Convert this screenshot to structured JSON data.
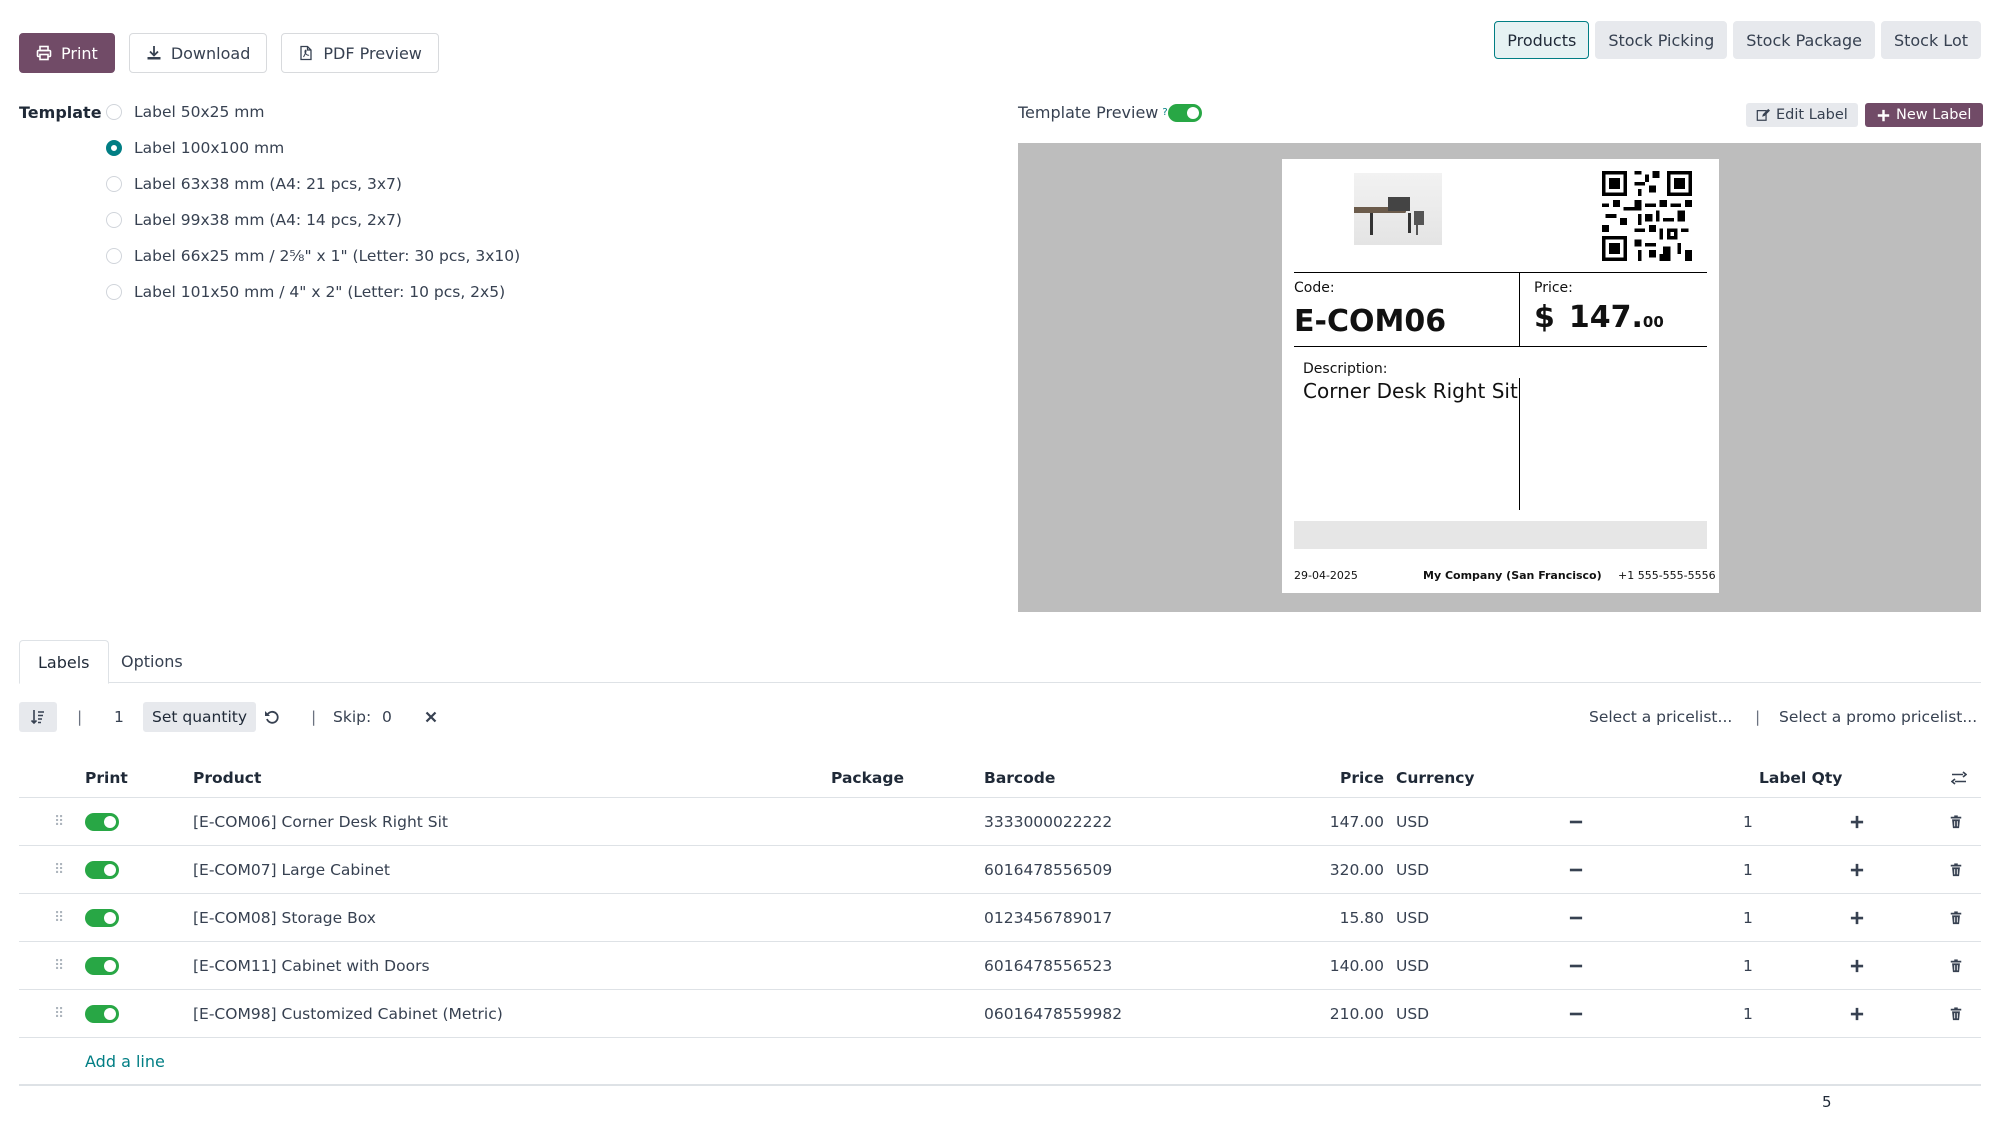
{
  "toolbar": {
    "print": "Print",
    "download": "Download",
    "pdf_preview": "PDF Preview"
  },
  "modes": [
    "Products",
    "Stock Picking",
    "Stock Package",
    "Stock Lot"
  ],
  "template": {
    "label": "Template",
    "options": [
      "Label 50x25 mm",
      "Label 100x100 mm",
      "Label 63x38 mm (A4: 21 pcs, 3x7)",
      "Label 99x38 mm (A4: 14 pcs, 2x7)",
      "Label 66x25 mm / 2⅝\" x 1\" (Letter: 30 pcs, 3x10)",
      "Label 101x50 mm / 4\" x 2\" (Letter: 10 pcs, 2x5)"
    ],
    "selected_index": 1
  },
  "preview": {
    "title": "Template Preview",
    "help": "?",
    "edit_label": "Edit Label",
    "new_label": "New Label"
  },
  "label_card": {
    "code_caption": "Code:",
    "code": "E-COM06",
    "price_caption": "Price:",
    "currency_symbol": "$",
    "price_int": "147.",
    "price_cents": "00",
    "description_caption": "Description:",
    "description": "Corner Desk Right Sit",
    "date": "29-04-2025",
    "company": "My Company (San Francisco)",
    "phone": "+1 555-555-5556"
  },
  "tabs": [
    "Labels",
    "Options"
  ],
  "controls": {
    "pipe": "|",
    "quantity": "1",
    "set_quantity": "Set quantity",
    "skip_label": "Skip:",
    "skip_value": "0",
    "pricelist_placeholder": "Select a pricelist...",
    "promo_placeholder": "Select a promo pricelist..."
  },
  "table": {
    "headers": {
      "print": "Print",
      "product": "Product",
      "package": "Package",
      "barcode": "Barcode",
      "price": "Price",
      "currency": "Currency",
      "label_qty": "Label Qty"
    },
    "rows": [
      {
        "product": "[E-COM06] Corner Desk Right Sit",
        "barcode": "3333000022222",
        "price": "147.00",
        "currency": "USD",
        "qty": "1",
        "print": true
      },
      {
        "product": "[E-COM07] Large Cabinet",
        "barcode": "6016478556509",
        "price": "320.00",
        "currency": "USD",
        "qty": "1",
        "print": true
      },
      {
        "product": "[E-COM08] Storage Box",
        "barcode": "0123456789017",
        "price": "15.80",
        "currency": "USD",
        "qty": "1",
        "print": true
      },
      {
        "product": "[E-COM11] Cabinet with Doors",
        "barcode": "6016478556523",
        "price": "140.00",
        "currency": "USD",
        "qty": "1",
        "print": true
      },
      {
        "product": "[E-COM98] Customized Cabinet (Metric)",
        "barcode": "06016478559982",
        "price": "210.00",
        "currency": "USD",
        "qty": "1",
        "print": true
      }
    ],
    "add_line": "Add a line",
    "total_qty": "5"
  },
  "colors": {
    "primary": "#714b67",
    "accent": "#017e84",
    "toggle_on": "#28a745"
  }
}
